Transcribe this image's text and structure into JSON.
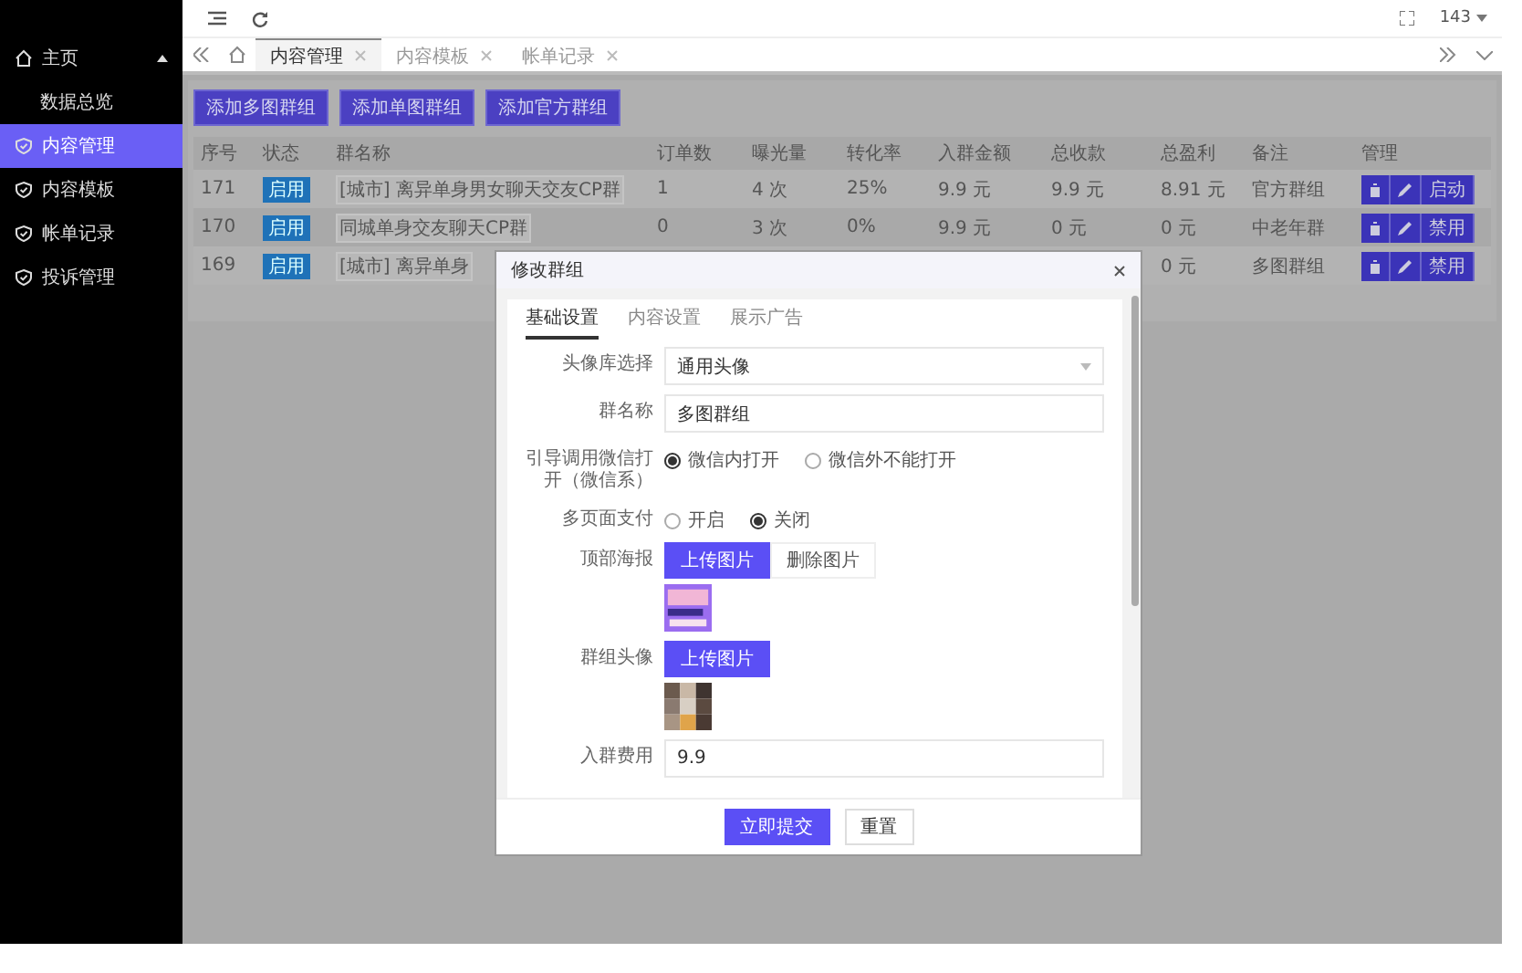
{
  "sidebar": {
    "items": [
      {
        "label": "主页",
        "kind": "home",
        "selected": false,
        "expanded": true,
        "children": [
          {
            "label": "数据总览",
            "selected": false
          }
        ]
      },
      {
        "label": "内容管理",
        "kind": "shield",
        "selected": true
      },
      {
        "label": "内容模板",
        "kind": "shield",
        "selected": false
      },
      {
        "label": "帐单记录",
        "kind": "shield",
        "selected": false
      },
      {
        "label": "投诉管理",
        "kind": "shield",
        "selected": false
      }
    ]
  },
  "header": {
    "user": "143"
  },
  "tabs": [
    {
      "label": "内容管理",
      "selected": true
    },
    {
      "label": "内容模板",
      "selected": false
    },
    {
      "label": "帐单记录",
      "selected": false
    }
  ],
  "actions": [
    "添加多图群组",
    "添加单图群组",
    "添加官方群组"
  ],
  "table": {
    "columns": [
      "序号",
      "状态",
      "群名称",
      "订单数",
      "曝光量",
      "转化率",
      "入群金额",
      "总收款",
      "总盈利",
      "备注",
      "管理"
    ],
    "rows": [
      {
        "index": "171",
        "status": "启用",
        "name": "[城市] 离异单身男女聊天交友CP群",
        "orders": "1",
        "exposure": "4 次",
        "conversion": "25%",
        "amount": "9.9 元",
        "income": "9.9 元",
        "profit": "8.91 元",
        "note": "官方群组",
        "toggle": "启动"
      },
      {
        "index": "170",
        "status": "启用",
        "name": "同城单身交友聊天CP群",
        "orders": "0",
        "exposure": "3 次",
        "conversion": "0%",
        "amount": "9.9 元",
        "income": "0 元",
        "profit": "0 元",
        "note": "中老年群",
        "toggle": "禁用"
      },
      {
        "index": "169",
        "status": "启用",
        "name": "[城市] 离异单身",
        "profit": "0 元",
        "note": "多图群组",
        "toggle": "禁用"
      }
    ]
  },
  "modal": {
    "title": "修改群组",
    "tabs": [
      {
        "label": "基础设置",
        "selected": true
      },
      {
        "label": "内容设置",
        "selected": false
      },
      {
        "label": "展示广告",
        "selected": false
      }
    ],
    "fields": [
      {
        "kind": "select",
        "label": "头像库选择",
        "value": "通用头像"
      },
      {
        "kind": "input",
        "label": "群名称",
        "value": "多图群组"
      },
      {
        "kind": "radio",
        "label": "引导调用微信打开（微信系）",
        "options": [
          {
            "label": "微信内打开",
            "selected": true
          },
          {
            "label": "微信外不能打开",
            "selected": false
          }
        ]
      },
      {
        "kind": "radio",
        "label": "多页面支付",
        "options": [
          {
            "label": "开启",
            "selected": false
          },
          {
            "label": "关闭",
            "selected": true
          }
        ]
      },
      {
        "kind": "upload",
        "label": "顶部海报",
        "buttons": [
          "上传图片",
          "删除图片"
        ]
      },
      {
        "kind": "upload",
        "label": "群组头像",
        "buttons": [
          "上传图片"
        ]
      },
      {
        "kind": "input",
        "label": "入群费用",
        "value": "9.9"
      }
    ],
    "buttons": [
      "立即提交",
      "重置"
    ]
  }
}
